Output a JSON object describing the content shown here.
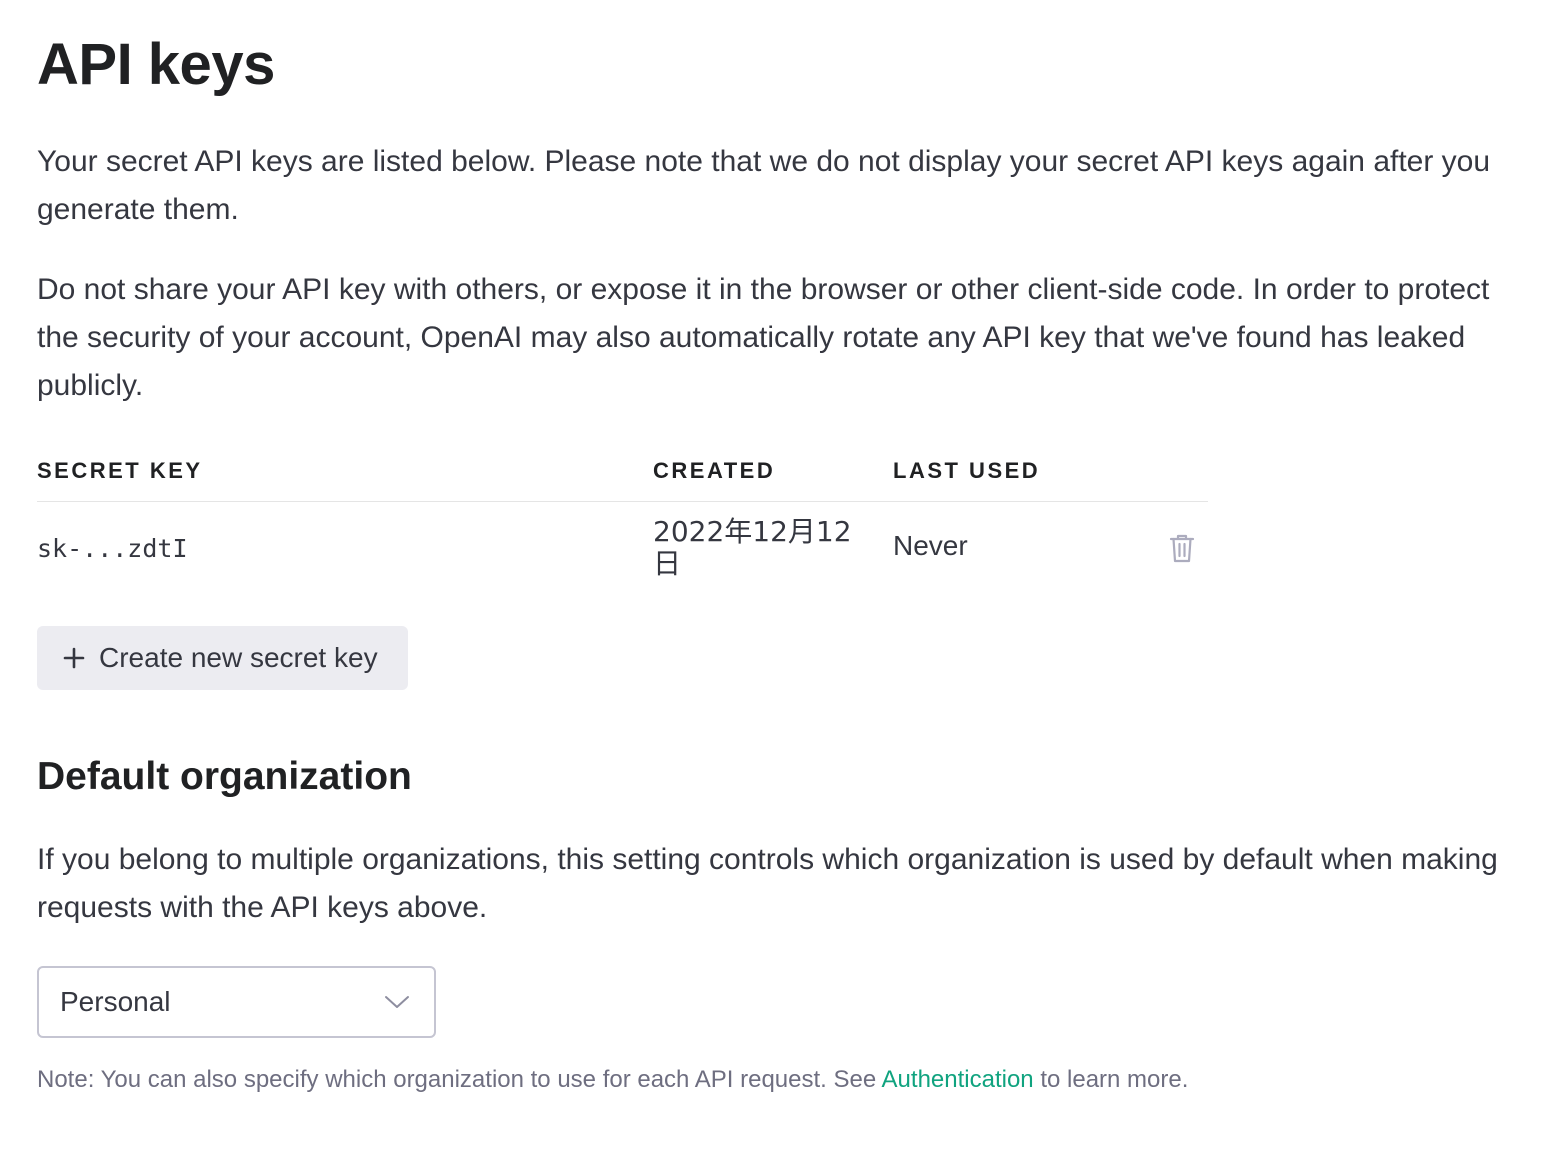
{
  "header": {
    "title": "API keys"
  },
  "intro": {
    "paragraph1": "Your secret API keys are listed below. Please note that we do not display your secret API keys again after you generate them.",
    "paragraph2": "Do not share your API key with others, or expose it in the browser or other client-side code. In order to protect the security of your account, OpenAI may also automatically rotate any API key that we've found has leaked publicly."
  },
  "keys_table": {
    "columns": [
      "SECRET KEY",
      "CREATED",
      "LAST USED"
    ],
    "rows": [
      {
        "secret_key": "sk-...zdtI",
        "created": "2022年12月12日",
        "last_used": "Never"
      }
    ]
  },
  "actions": {
    "create_key_label": "Create new secret key"
  },
  "default_org": {
    "title": "Default organization",
    "description": "If you belong to multiple organizations, this setting controls which organization is used by default when making requests with the API keys above.",
    "selected": "Personal",
    "note_prefix": "Note: You can also specify which organization to use for each API request. See ",
    "note_link": "Authentication",
    "note_suffix": " to learn more."
  },
  "icons": {
    "delete": "trash-icon",
    "create": "plus-icon",
    "dropdown": "chevron-down-icon"
  },
  "colors": {
    "link": "#10a37f",
    "button_bg": "#ececf1",
    "text": "#353740",
    "heading": "#202123"
  }
}
